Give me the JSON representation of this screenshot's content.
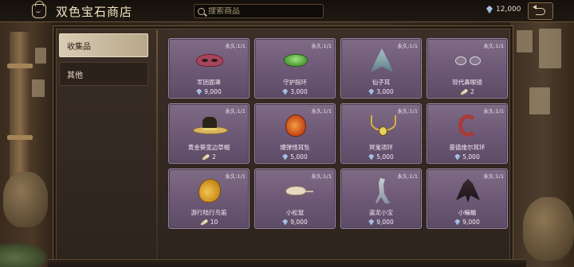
{
  "header": {
    "title": "双色宝石商店",
    "search_placeholder": "搜索商品",
    "currency_amount": "12,000",
    "currency_icon": "gem-icon"
  },
  "sidebar": {
    "tabs": [
      {
        "label": "收集品",
        "active": true
      },
      {
        "label": "其他",
        "active": false
      }
    ]
  },
  "items": [
    {
      "name": "军团面罩",
      "limit": "永久:1/1",
      "price": "9,000",
      "currency": "gem",
      "icon": "mask-icon"
    },
    {
      "name": "守护指环",
      "limit": "永久:1/1",
      "price": "3,000",
      "currency": "gem",
      "icon": "ring-icon"
    },
    {
      "name": "仙子耳",
      "limit": "永久:1/1",
      "price": "3,000",
      "currency": "gem",
      "icon": "fairy-ears-icon"
    },
    {
      "name": "现代鼻眼镜",
      "limit": "永久:1/1",
      "price": "2",
      "currency": "feather",
      "icon": "glasses-icon"
    },
    {
      "name": "黄金葵宽边草帽",
      "limit": "永久:1/1",
      "price": "2",
      "currency": "feather",
      "icon": "hat-icon"
    },
    {
      "name": "爆弹怪耳坠",
      "limit": "永久:1/1",
      "price": "5,000",
      "currency": "gem",
      "icon": "earring-icon"
    },
    {
      "name": "冥鬼项环",
      "limit": "永久:1/1",
      "price": "5,000",
      "currency": "gem",
      "icon": "necklace-icon"
    },
    {
      "name": "曼德维尔耳环",
      "limit": "永久:1/1",
      "price": "5,000",
      "currency": "gem",
      "icon": "hook-earring-icon"
    },
    {
      "name": "游行陆行鸟笛",
      "limit": "永久:1/1",
      "price": "10",
      "currency": "feather",
      "icon": "bird-whistle-icon"
    },
    {
      "name": "小松鼠",
      "limit": "永久:1/1",
      "price": "9,000",
      "currency": "gem",
      "icon": "mouse-icon"
    },
    {
      "name": "盗龙小宝",
      "limit": "永久:1/1",
      "price": "9,000",
      "currency": "gem",
      "icon": "raptor-icon"
    },
    {
      "name": "小蝙蝠",
      "limit": "永久:1/1",
      "price": "9,000",
      "currency": "gem",
      "icon": "bat-icon"
    }
  ]
}
